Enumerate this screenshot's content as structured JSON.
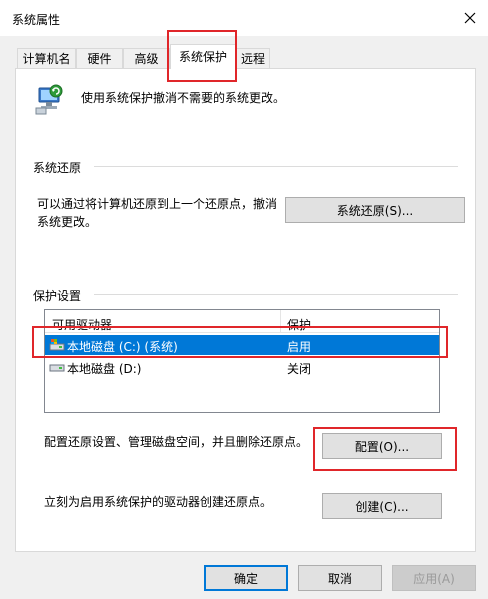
{
  "window": {
    "title": "系统属性"
  },
  "tabs": [
    {
      "label": "计算机名"
    },
    {
      "label": "硬件"
    },
    {
      "label": "高级"
    },
    {
      "label": "系统保护"
    },
    {
      "label": "远程"
    }
  ],
  "header": {
    "description": "使用系统保护撤消不需要的系统更改。"
  },
  "restore": {
    "group_label": "系统还原",
    "description_line1": "可以通过将计算机还原到上一个还原点，撤消",
    "description_line2": "系统更改。",
    "button_label": "系统还原(S)..."
  },
  "protection": {
    "group_label": "保护设置",
    "columns": [
      "可用驱动器",
      "保护"
    ],
    "rows": [
      {
        "drive": "本地磁盘 (C:) (系统)",
        "status": "启用"
      },
      {
        "drive": "本地磁盘 (D:)",
        "status": "关闭"
      }
    ],
    "configure_text": "配置还原设置、管理磁盘空间，并且删除还原点。",
    "configure_button": "配置(O)...",
    "create_text": "立刻为启用系统保护的驱动器创建还原点。",
    "create_button": "创建(C)..."
  },
  "footer": {
    "ok": "确定",
    "cancel": "取消",
    "apply": "应用(A)"
  },
  "colors": {
    "selection": "#0078d7",
    "highlight_box": "#e0262a",
    "panel_bg": "#ffffff",
    "window_bg": "#f0f0f0"
  }
}
